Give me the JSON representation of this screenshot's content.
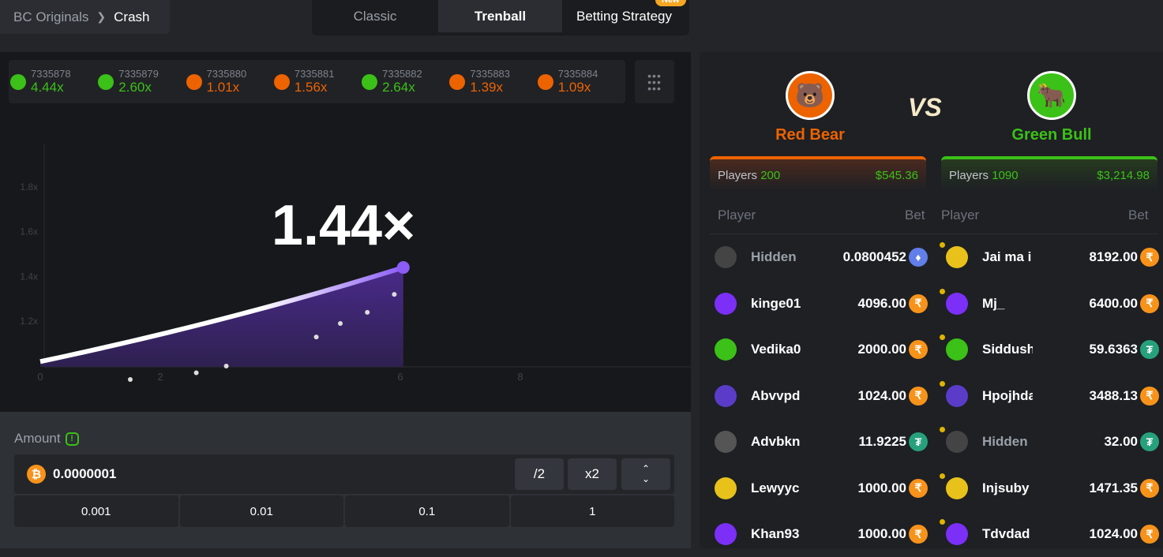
{
  "breadcrumb": {
    "parent": "BC Originals",
    "current": "Crash"
  },
  "tabs": [
    {
      "label": "Classic"
    },
    {
      "label": "Trenball"
    },
    {
      "label": "Betting Strategy"
    }
  ],
  "tab_badge": "New",
  "active_tab": "Trenball",
  "history": [
    {
      "id": "7335878",
      "value": "4.44x",
      "color": "#3bc117"
    },
    {
      "id": "7335879",
      "value": "2.60x",
      "color": "#3bc117"
    },
    {
      "id": "7335880",
      "value": "1.01x",
      "color": "#ed6300"
    },
    {
      "id": "7335881",
      "value": "1.56x",
      "color": "#ed6300"
    },
    {
      "id": "7335882",
      "value": "2.64x",
      "color": "#3bc117"
    },
    {
      "id": "7335883",
      "value": "1.39x",
      "color": "#ed6300"
    },
    {
      "id": "7335884",
      "value": "1.09x",
      "color": "#ed6300"
    }
  ],
  "chart_data": {
    "type": "line",
    "current_multiplier": "1.44×",
    "x_ticks": [
      "0",
      "2",
      "6",
      "8"
    ],
    "y_ticks": [
      "1.2x",
      "1.4x",
      "1.6x",
      "1.8x"
    ],
    "xlim": [
      0,
      8.5
    ],
    "ylim": [
      1.0,
      2.0
    ],
    "curve_end": {
      "x": 6.05,
      "y": 1.44
    },
    "line_color": "#8b5cf6"
  },
  "controls": {
    "amount_label": "Amount",
    "amount_value": "0.0000001",
    "half_label": "/2",
    "double_label": "x2",
    "quick": [
      "0.001",
      "0.01",
      "0.1",
      "1"
    ]
  },
  "teams": {
    "red": {
      "name": "Red Bear",
      "players_label": "Players",
      "players": "200",
      "total": "$545.36",
      "color": "#ed6300"
    },
    "green": {
      "name": "Green Bull",
      "players_label": "Players",
      "players": "1090",
      "total": "$3,214.98",
      "color": "#3bc117"
    },
    "vs": "VS"
  },
  "table_headers": {
    "player": "Player",
    "bet": "Bet"
  },
  "red_bets": [
    {
      "name": "Hidden",
      "bet": "0.0800452",
      "currency": "eth"
    },
    {
      "name": "kinge01",
      "bet": "4096.00",
      "currency": "inr"
    },
    {
      "name": "Vedika0",
      "bet": "2000.00",
      "currency": "inr"
    },
    {
      "name": "Abvvpd",
      "bet": "1024.00",
      "currency": "inr"
    },
    {
      "name": "Advbkn",
      "bet": "11.9225",
      "currency": "usdt"
    },
    {
      "name": "Lewyyc",
      "bet": "1000.00",
      "currency": "inr"
    },
    {
      "name": "Khan93",
      "bet": "1000.00",
      "currency": "inr"
    }
  ],
  "green_bets": [
    {
      "name": "Jai ma i",
      "bet": "8192.00",
      "currency": "inr"
    },
    {
      "name": "Mj_",
      "bet": "6400.00",
      "currency": "inr"
    },
    {
      "name": "Siddush",
      "bet": "59.6363",
      "currency": "usdt"
    },
    {
      "name": "Hpojhda",
      "bet": "3488.13",
      "currency": "inr"
    },
    {
      "name": "Hidden",
      "bet": "32.00",
      "currency": "usdt"
    },
    {
      "name": "Injsuby",
      "bet": "1471.35",
      "currency": "inr"
    },
    {
      "name": "Tdvdad",
      "bet": "1024.00",
      "currency": "inr"
    }
  ]
}
